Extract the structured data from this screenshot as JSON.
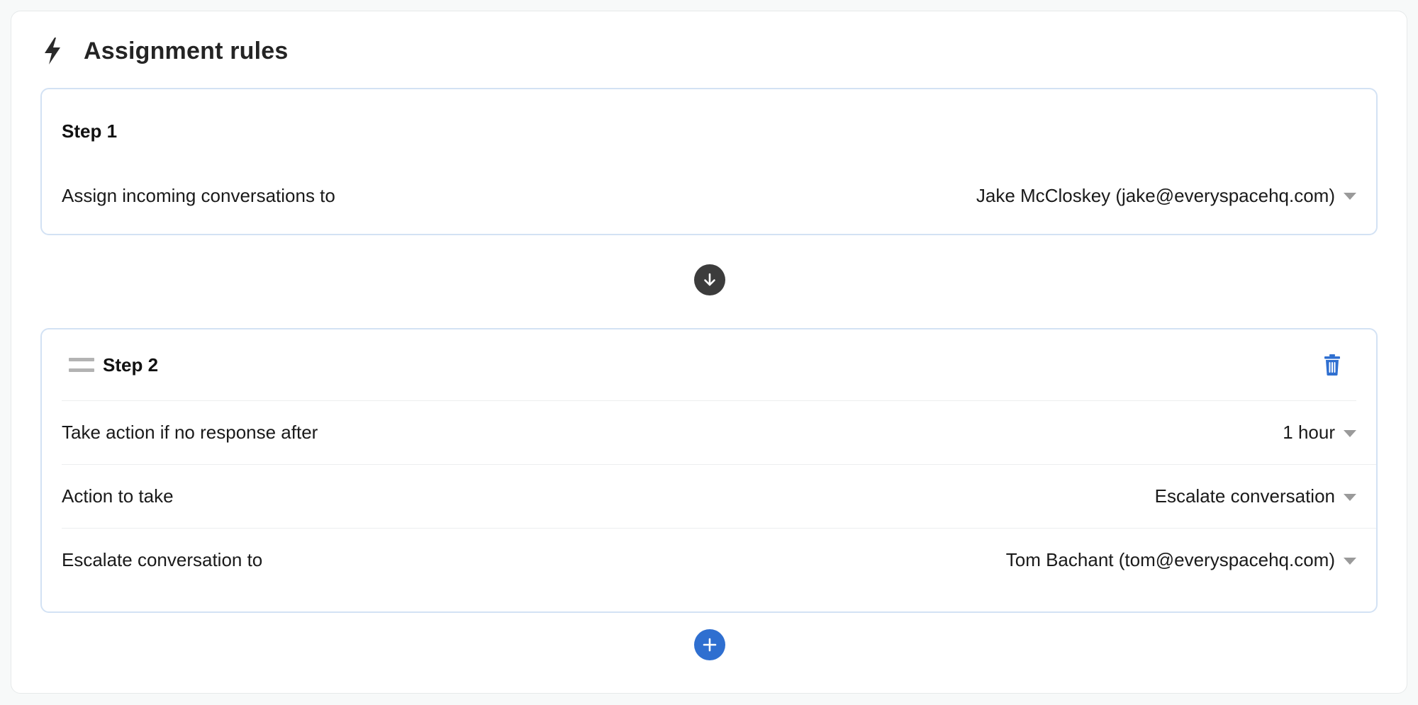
{
  "header": {
    "title": "Assignment rules",
    "icon": "lightning-bolt-icon"
  },
  "steps": [
    {
      "title": "Step 1",
      "rows": [
        {
          "label": "Assign incoming conversations to",
          "value": "Jake McCloskey (jake@everyspacehq.com)"
        }
      ]
    },
    {
      "title": "Step 2",
      "rows": [
        {
          "label": "Take action if no response after",
          "value": "1 hour"
        },
        {
          "label": "Action to take",
          "value": "Escalate conversation"
        },
        {
          "label": "Escalate conversation to",
          "value": "Tom Bachant (tom@everyspacehq.com)"
        }
      ]
    }
  ],
  "colors": {
    "accent": "#2f6fd0",
    "card_border": "#d3e2f4",
    "connector": "#3c3c3c",
    "caret": "#9a9a9a"
  }
}
